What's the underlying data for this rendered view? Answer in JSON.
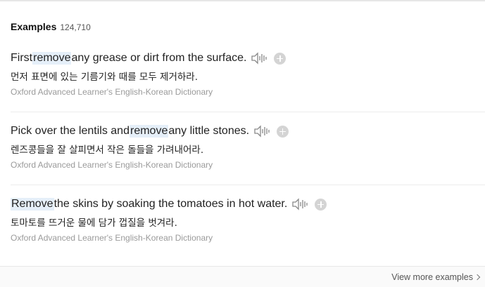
{
  "header": {
    "title": "Examples",
    "count": "124,710"
  },
  "examples": [
    {
      "en_before": "First ",
      "en_highlight": "remove",
      "en_after": " any grease or dirt from the surface.",
      "ko": "먼저 표면에 있는 기름기와 때를 모두 제거하라.",
      "source": "Oxford Advanced Learner's English-Korean Dictionary"
    },
    {
      "en_before": "Pick over the lentils and ",
      "en_highlight": "remove",
      "en_after": " any little stones.",
      "ko": "렌즈콩들을 잘 살피면서 작은 돌들을 가려내어라.",
      "source": "Oxford Advanced Learner's English-Korean Dictionary"
    },
    {
      "en_before": "",
      "en_highlight": "Remove",
      "en_after": " the skins by soaking the tomatoes in hot water.",
      "ko": "토마토를 뜨거운 물에 담가 껍질을 벗겨라.",
      "source": "Oxford Advanced Learner's English-Korean Dictionary"
    }
  ],
  "footer": {
    "view_more_label": "View more examples"
  },
  "icons": {
    "speaker": "speaker-icon",
    "add": "plus-circle-icon",
    "more": "chevron-right-icon"
  },
  "colors": {
    "highlight": "#e5eff9",
    "source_text": "#9a9a9a",
    "icon_gray": "#d4d4d4"
  }
}
